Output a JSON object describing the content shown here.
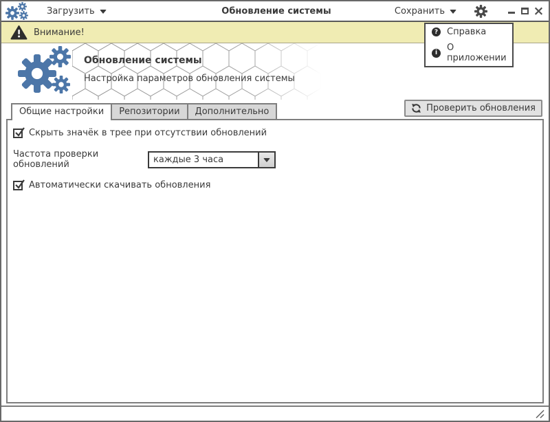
{
  "titlebar": {
    "load_label": "Загрузить",
    "title": "Обновление системы",
    "save_label": "Сохранить"
  },
  "warning": {
    "text": "Внимание!"
  },
  "dropdown_menu": {
    "items": [
      {
        "icon": "help-circle-icon",
        "glyph": "?",
        "label": "Справка"
      },
      {
        "icon": "info-circle-icon",
        "glyph": "i",
        "label": "О приложении"
      }
    ]
  },
  "header": {
    "title": "Обновление системы",
    "subtitle": "Настройка параметров обновления системы"
  },
  "tabs": [
    {
      "label": "Общие настройки",
      "active": true
    },
    {
      "label": "Репозитории",
      "active": false
    },
    {
      "label": "Дополнительно",
      "active": false
    }
  ],
  "actions": {
    "check_updates_label": "Проверить обновления"
  },
  "general_settings": {
    "hide_tray": {
      "label": "Скрыть значёк в трее при отсутствии обновлений",
      "checked": true
    },
    "frequency": {
      "label": "Частота проверки обновлений",
      "value": "каждые 3 часа"
    },
    "auto_download": {
      "label": "Автоматически скачивать обновления",
      "checked": true
    }
  },
  "colors": {
    "accent_blue": "#4c76a8",
    "warning_yellow": "#f0ecb3",
    "icon_dark": "#2d2d2d"
  }
}
